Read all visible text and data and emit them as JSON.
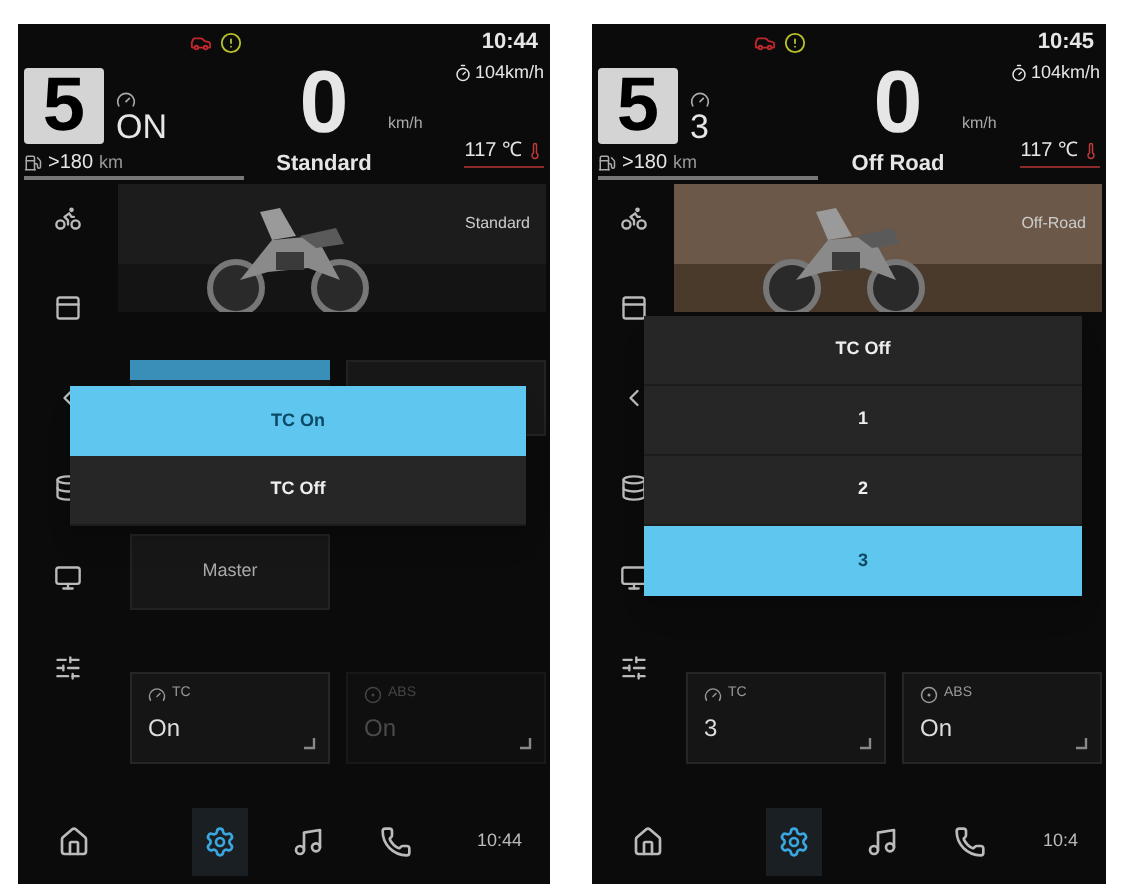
{
  "screens": [
    {
      "time": "10:44",
      "gear": "5",
      "tc_value": "ON",
      "speed": "0",
      "speed_unit": "km/h",
      "mode": "Standard",
      "cruise": "104km/h",
      "range_value": ">180",
      "range_unit": "km",
      "temperature": "117 ℃",
      "picture_label": "Standard",
      "tiles": [
        {
          "selected": true
        },
        {
          "selected": false
        },
        {
          "label": "Master",
          "selected": false
        }
      ],
      "popup": [
        {
          "label": "TC On",
          "selected": true
        },
        {
          "label": "TC Off",
          "selected": false
        }
      ],
      "cards": [
        {
          "kind": "tc",
          "title": "TC",
          "value": "On",
          "disabled": false
        },
        {
          "kind": "abs",
          "title": "ABS",
          "value": "On",
          "disabled": true
        }
      ],
      "nav": [
        {
          "kind": "home",
          "selected": false
        },
        {
          "kind": "settings",
          "selected": true
        },
        {
          "kind": "music",
          "selected": false
        },
        {
          "kind": "phone",
          "selected": false
        }
      ],
      "clock": "10:44"
    },
    {
      "time": "10:45",
      "gear": "5",
      "tc_value": "3",
      "speed": "0",
      "speed_unit": "km/h",
      "mode": "Off Road",
      "cruise": "104km/h",
      "range_value": ">180",
      "range_unit": "km",
      "temperature": "117 ℃",
      "picture_label": "Off-Road",
      "popup": [
        {
          "label": "TC Off",
          "selected": false
        },
        {
          "label": "1",
          "selected": false
        },
        {
          "label": "2",
          "selected": false
        },
        {
          "label": "3",
          "selected": true
        }
      ],
      "cards": [
        {
          "kind": "tc",
          "title": "TC",
          "value": "3",
          "disabled": false
        },
        {
          "kind": "abs",
          "title": "ABS",
          "value": "On",
          "disabled": false
        }
      ],
      "nav": [
        {
          "kind": "home",
          "selected": false
        },
        {
          "kind": "settings",
          "selected": true
        },
        {
          "kind": "music",
          "selected": false
        },
        {
          "kind": "phone",
          "selected": false
        }
      ],
      "clock": "10:4"
    }
  ]
}
